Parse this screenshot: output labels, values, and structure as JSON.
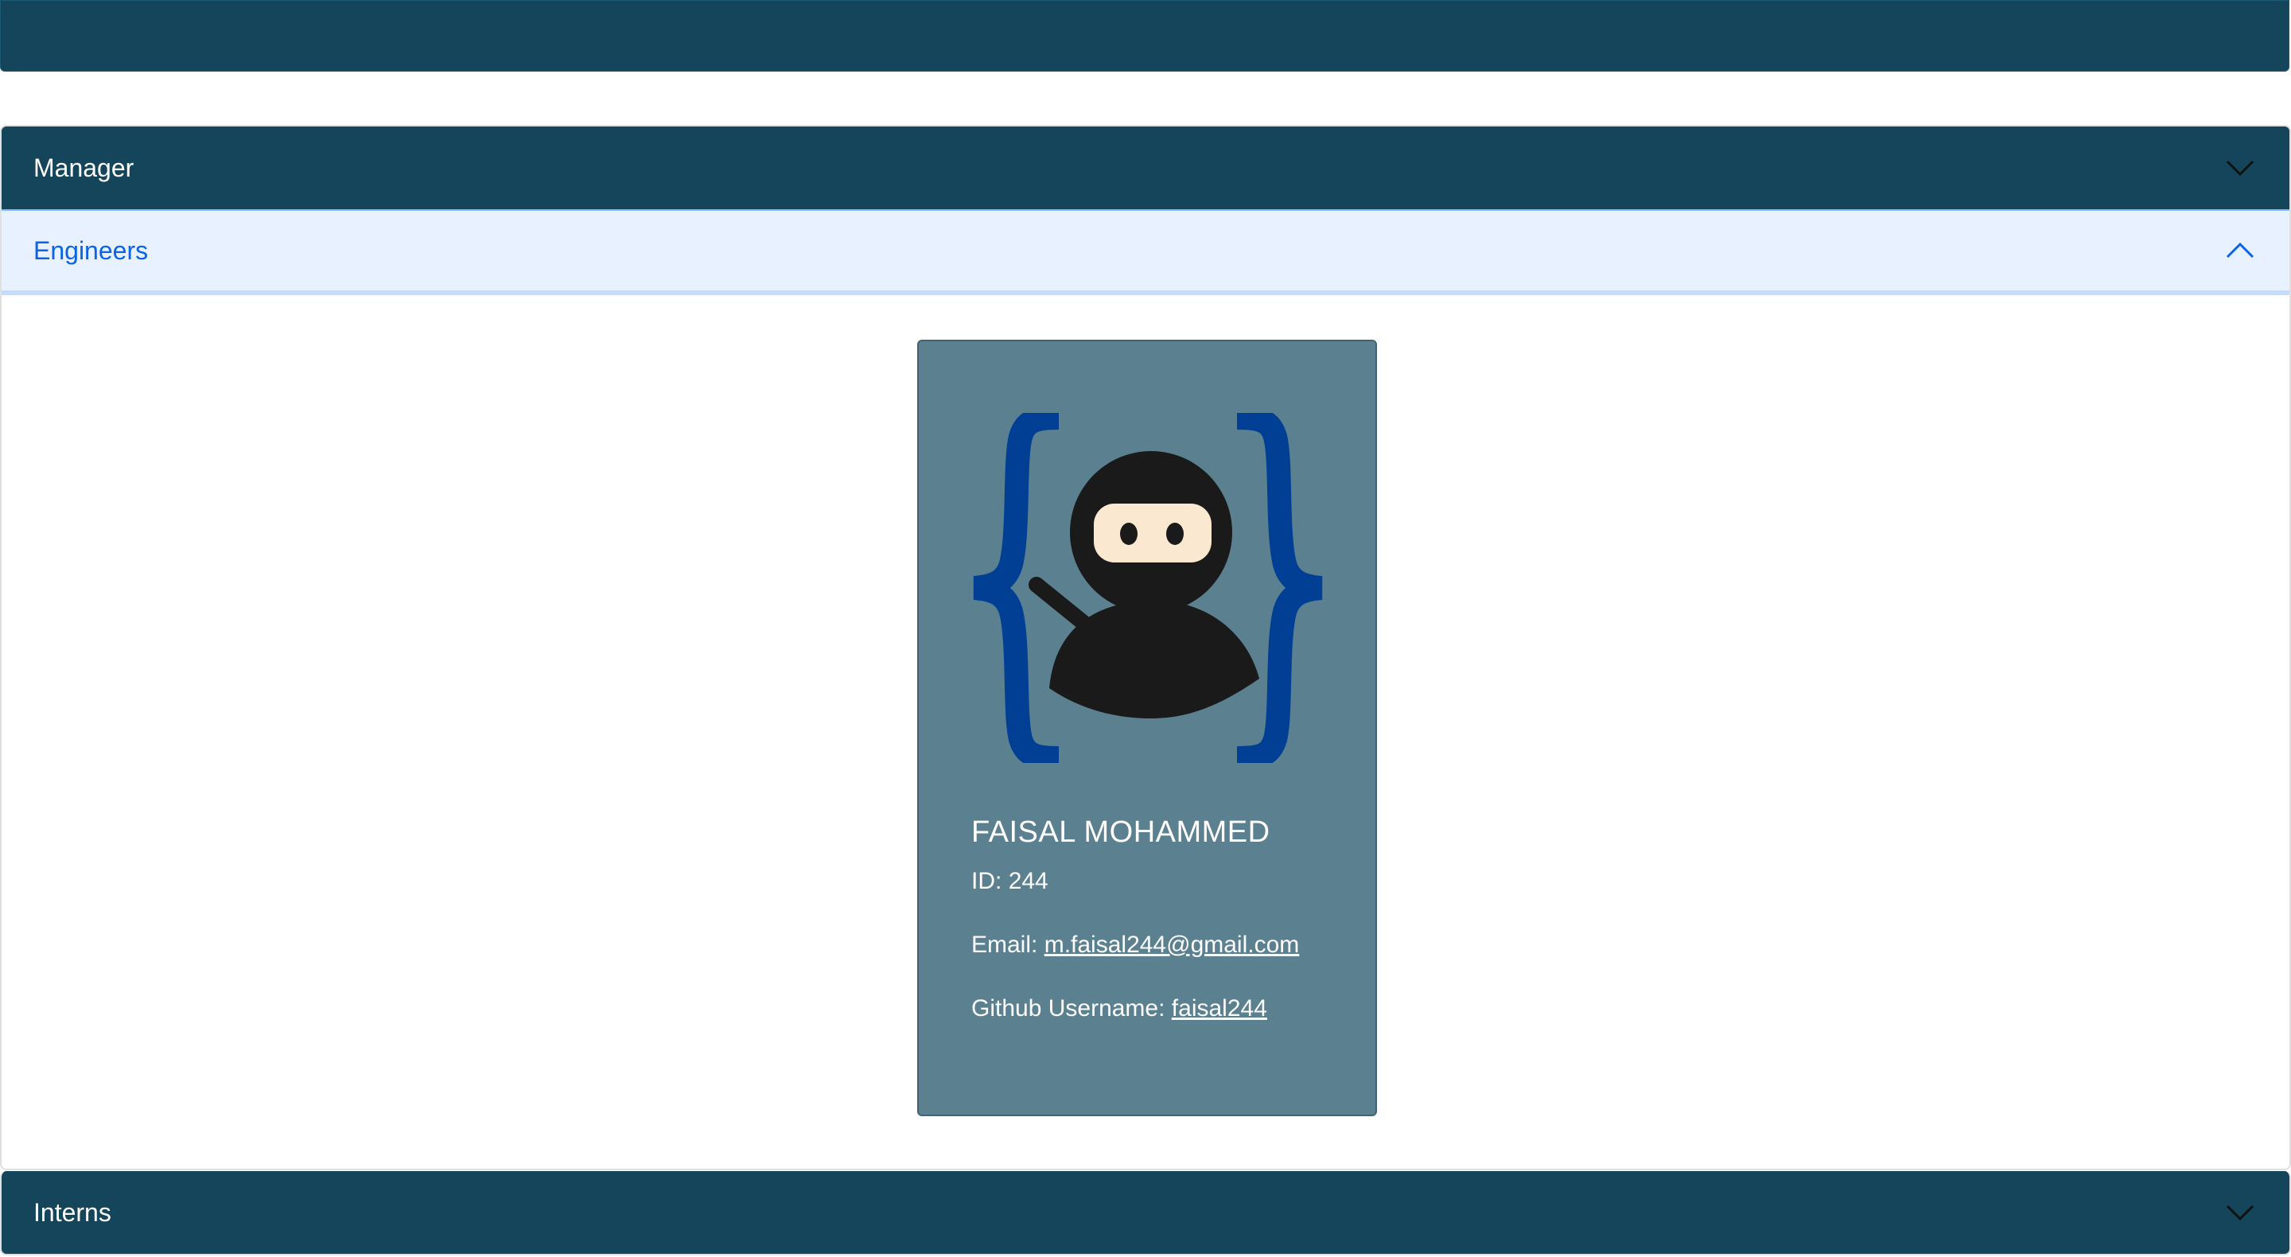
{
  "accordion": {
    "sections": [
      {
        "label": "Manager",
        "expanded": false
      },
      {
        "label": "Engineers",
        "expanded": true
      },
      {
        "label": "Interns",
        "expanded": false
      }
    ]
  },
  "engineer_card": {
    "name": "FAISAL MOHAMMED",
    "id_label": "ID:",
    "id_value": "244",
    "email_label": "Email:",
    "email_value": "m.faisal244@gmail.com",
    "github_label": "Github Username:",
    "github_value": "faisal244",
    "avatar_icon": "ninja-developer-icon"
  },
  "colors": {
    "navbar": "#14455b",
    "header_dark": "#14455b",
    "header_open_bg": "#e7f1ff",
    "header_open_text": "#0c63e4",
    "card_bg": "#5b8191",
    "brace_blue": "#003f94"
  }
}
